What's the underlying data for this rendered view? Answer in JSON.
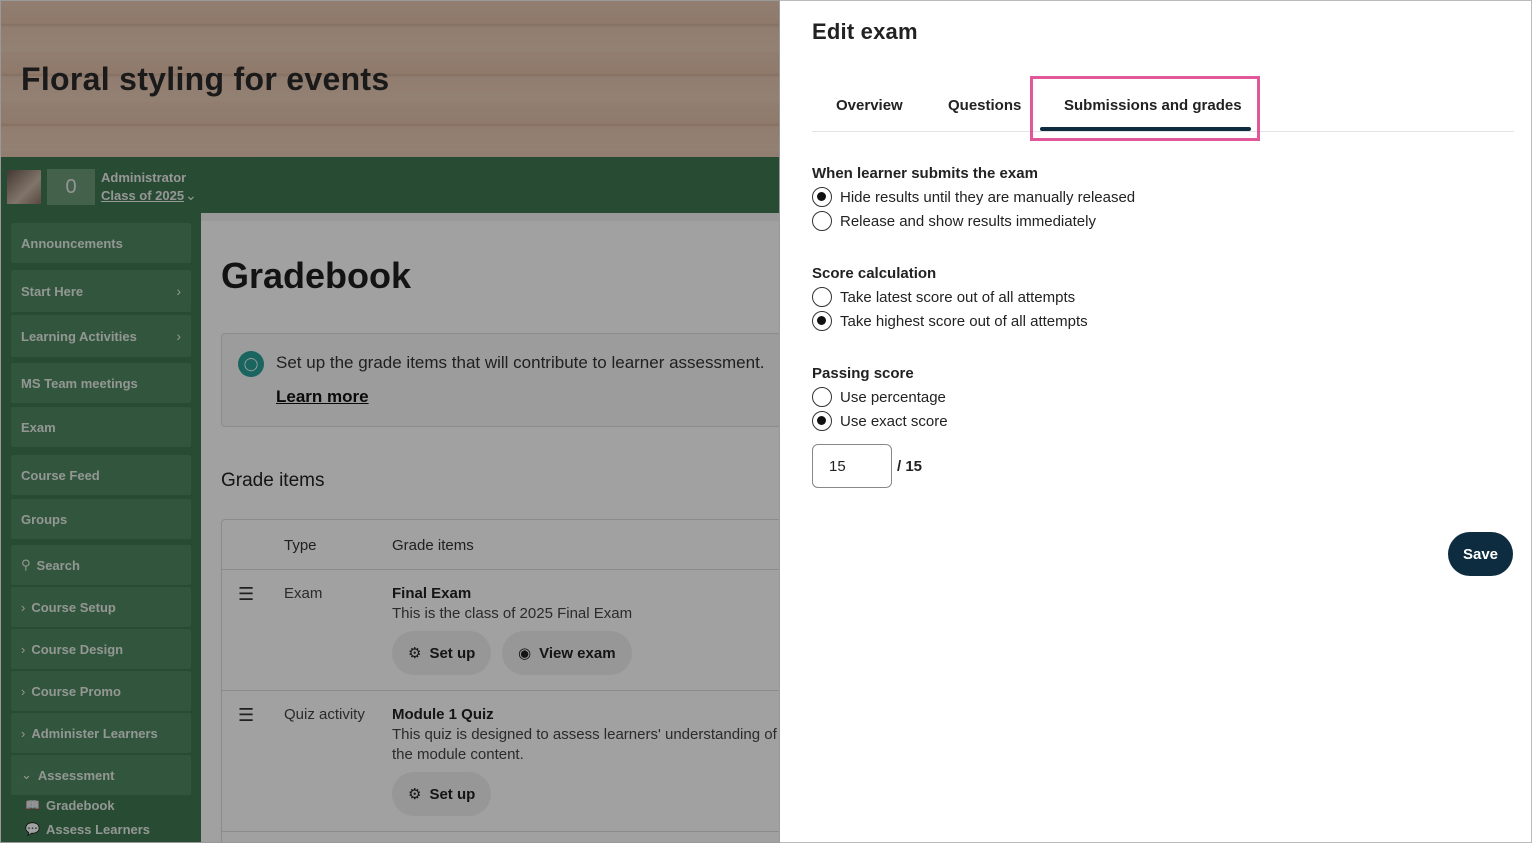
{
  "course": {
    "title": "Floral styling for events",
    "user_role": "Administrator",
    "user_class": "Class of 2025",
    "points": "0"
  },
  "sidebar": {
    "items": [
      {
        "label": "Announcements"
      },
      {
        "label": "Start Here"
      },
      {
        "label": "Learning Activities"
      },
      {
        "label": "MS Team meetings"
      },
      {
        "label": "Exam"
      },
      {
        "label": "Course Feed"
      },
      {
        "label": "Groups"
      },
      {
        "label": "Search"
      },
      {
        "label": "Course Setup"
      },
      {
        "label": "Course Design"
      },
      {
        "label": "Course Promo"
      },
      {
        "label": "Administer Learners"
      },
      {
        "label": "Assessment"
      }
    ],
    "sub_items": [
      {
        "label": "Gradebook"
      },
      {
        "label": "Assess Learners"
      }
    ]
  },
  "gradebook": {
    "title": "Gradebook",
    "tip": "Set up the grade items that will contribute to learner assessment.",
    "learn_more": "Learn more",
    "grade_items_title": "Grade items",
    "columns": [
      "Type",
      "Grade items"
    ],
    "rows": [
      {
        "type": "Exam",
        "title": "Final Exam",
        "description": "This is the class of 2025 Final Exam",
        "actions": [
          "Set up",
          "View exam"
        ]
      },
      {
        "type": "Quiz activity",
        "title": "Module 1 Quiz",
        "description": "This quiz is designed to assess learners' understanding of the module content.",
        "actions": [
          "Set up"
        ]
      }
    ]
  },
  "panel": {
    "title": "Edit exam",
    "tabs": [
      {
        "label": "Overview"
      },
      {
        "label": "Questions"
      },
      {
        "label": "Submissions and grades",
        "active": true
      }
    ],
    "sections": [
      {
        "label": "When learner submits the exam",
        "options": [
          {
            "label": "Hide results until they are manually released",
            "checked": true
          },
          {
            "label": "Release and show results immediately",
            "checked": false
          }
        ]
      },
      {
        "label": "Score calculation",
        "options": [
          {
            "label": "Take latest score out of all attempts",
            "checked": false
          },
          {
            "label": "Take highest score out of all attempts",
            "checked": true
          }
        ]
      },
      {
        "label": "Passing score",
        "options": [
          {
            "label": "Use percentage",
            "checked": false
          },
          {
            "label": "Use exact score",
            "checked": true
          }
        ]
      }
    ],
    "passing_score_value": "15",
    "passing_score_total": "/ 15",
    "save_label": "Save"
  },
  "colors": {
    "sidebar_green": "#3f7752",
    "primary_navy": "#0e2c3f",
    "highlight_pink": "#e0579a",
    "tip_teal": "#2aa197"
  }
}
